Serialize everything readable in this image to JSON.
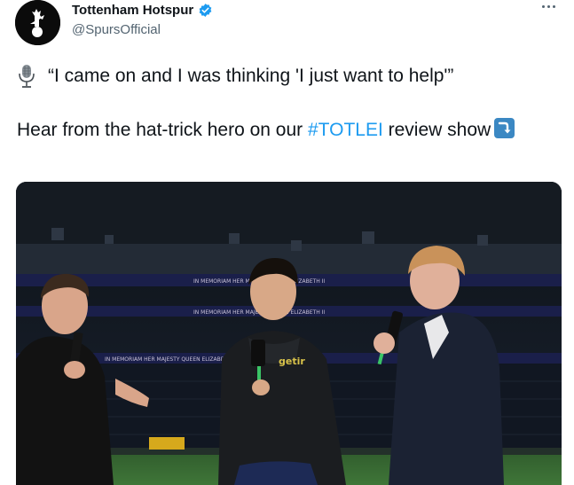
{
  "account": {
    "display_name": "Tottenham Hotspur",
    "handle": "@SpursOfficial",
    "verified_icon": "verified-badge-icon",
    "avatar_icon": "cockerel-logo-icon"
  },
  "tweet": {
    "quote": "“I came on and I was thinking 'I just want to help'”",
    "body_prefix": "Hear from the hat-trick hero on our ",
    "hashtag": "#TOTLEI",
    "body_suffix": " review show",
    "mic_icon": "microphone-emoji-icon",
    "arrow_icon": "right-arrow-curving-down-emoji-icon"
  },
  "media": {
    "boards": [
      "IN MEMORIAM HER MAJESTY QUEEN ELIZABETH II",
      "IN MEMORIAM HER MAJESTY QUEEN ELIZABETH II",
      "IN MEMORIAM HER MAJESTY QUEEN ELIZABETH II"
    ],
    "shirt_text": "getir"
  },
  "colors": {
    "link": "#1d9bf0",
    "secondary_text": "#536471",
    "verified": "#1d9bf0"
  }
}
